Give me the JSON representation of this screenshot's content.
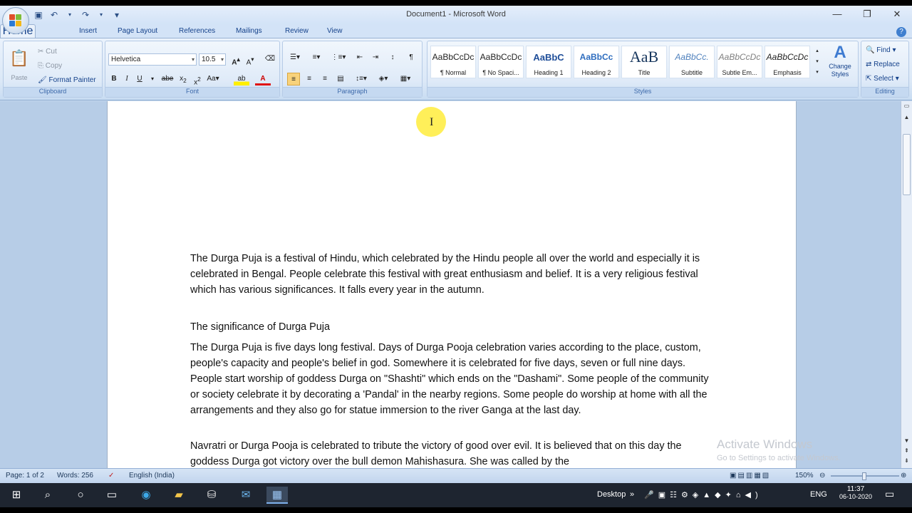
{
  "app": {
    "title": "Document1 - Microsoft Word",
    "quick_access": [
      "save-icon",
      "undo-icon",
      "redo-icon",
      "customize-icon"
    ]
  },
  "tabs": [
    "Home",
    "Insert",
    "Page Layout",
    "References",
    "Mailings",
    "Review",
    "View"
  ],
  "ribbon": {
    "clipboard": {
      "label": "Clipboard",
      "paste": "Paste",
      "cut": "Cut",
      "copy": "Copy",
      "format_painter": "Format Painter"
    },
    "font": {
      "label": "Font",
      "family": "Helvetica",
      "size": "10.5"
    },
    "paragraph": {
      "label": "Paragraph"
    },
    "styles": {
      "label": "Styles",
      "items": [
        {
          "preview": "AaBbCcDc",
          "name": "¶ Normal"
        },
        {
          "preview": "AaBbCcDc",
          "name": "¶ No Spaci..."
        },
        {
          "preview": "AaBbC",
          "name": "Heading 1"
        },
        {
          "preview": "AaBbCc",
          "name": "Heading 2"
        },
        {
          "preview": "AaB",
          "name": "Title"
        },
        {
          "preview": "AaBbCc.",
          "name": "Subtitle"
        },
        {
          "preview": "AaBbCcDc",
          "name": "Subtle Em..."
        },
        {
          "preview": "AaBbCcDc",
          "name": "Emphasis"
        }
      ],
      "change_styles": "Change Styles"
    },
    "editing": {
      "label": "Editing",
      "find": "Find",
      "replace": "Replace",
      "select": "Select"
    }
  },
  "document": {
    "p1": "The Durga Puja is a festival of Hindu, which celebrated by the Hindu people all over the world and especially it is celebrated in Bengal. People celebrate this festival with great enthusiasm and belief. It is a very religious festival which has various significances. It falls every year in the autumn.",
    "heading": "The significance of Durga Puja",
    "p2": "The Durga Puja is five days long festival. Days of Durga Pooja celebration varies according to the place, custom, people's capacity and people's belief in god. Somewhere it is celebrated for five days, seven or full nine days. People start worship of goddess Durga on \"Shashti\" which ends on the \"Dashami\". Some people of the community or society celebrate it by decorating a 'Pandal' in the nearby regions. Some people do worship at home with all the arrangements and they also go for statue immersion to the river Ganga at the last day.",
    "p3": "Navratri or Durga Pooja is celebrated to tribute the victory of good over evil. It is believed that on this day the goddess Durga got victory over the bull demon Mahishasura. She was called by the"
  },
  "watermark": {
    "line1": "Activate Windows",
    "line2": "Go to Settings to activate Windows."
  },
  "status": {
    "page": "Page: 1 of 2",
    "words": "Words: 256",
    "language": "English (India)",
    "zoom": "150%"
  },
  "taskbar": {
    "desktop": "Desktop",
    "lang": "ENG",
    "time": "11:37",
    "date": "06-10-2020"
  }
}
